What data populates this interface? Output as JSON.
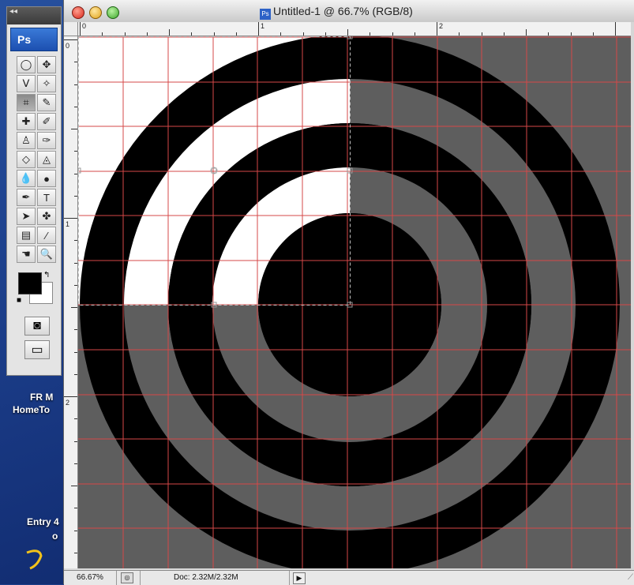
{
  "desktop": {
    "labels": [
      "FR M",
      "HomeTo",
      "Entry 4",
      "o"
    ]
  },
  "toolbox": {
    "logo": "Ps",
    "collapse_glyph": "◂◂",
    "tools": [
      {
        "name": "marquee-tool-icon",
        "glyph": "◯"
      },
      {
        "name": "move-tool-icon",
        "glyph": "✥"
      },
      {
        "name": "lasso-tool-icon",
        "glyph": "ᐯ"
      },
      {
        "name": "magic-wand-tool-icon",
        "glyph": "✧"
      },
      {
        "name": "crop-tool-icon",
        "glyph": "⌗"
      },
      {
        "name": "slice-tool-icon",
        "glyph": "✎"
      },
      {
        "name": "healing-brush-tool-icon",
        "glyph": "✚"
      },
      {
        "name": "brush-tool-icon",
        "glyph": "✐"
      },
      {
        "name": "clone-stamp-tool-icon",
        "glyph": "♙"
      },
      {
        "name": "history-brush-tool-icon",
        "glyph": "✑"
      },
      {
        "name": "eraser-tool-icon",
        "glyph": "◇"
      },
      {
        "name": "paint-bucket-tool-icon",
        "glyph": "◬"
      },
      {
        "name": "blur-tool-icon",
        "glyph": "💧"
      },
      {
        "name": "dodge-tool-icon",
        "glyph": "●"
      },
      {
        "name": "pen-tool-icon",
        "glyph": "✒"
      },
      {
        "name": "type-tool-icon",
        "glyph": "T"
      },
      {
        "name": "path-selection-tool-icon",
        "glyph": "➤"
      },
      {
        "name": "custom-shape-tool-icon",
        "glyph": "✤"
      },
      {
        "name": "notes-tool-icon",
        "glyph": "▤"
      },
      {
        "name": "eyedropper-tool-icon",
        "glyph": "⁄"
      },
      {
        "name": "hand-tool-icon",
        "glyph": "☚"
      },
      {
        "name": "zoom-tool-icon",
        "glyph": "🔍"
      }
    ],
    "active_tool": "crop-tool-icon",
    "fg_color": "#000000",
    "bg_color": "#ffffff",
    "swap_glyph": "↰",
    "default_glyph": "■",
    "quickmask_glyph": "◙",
    "screenmode_glyph": "▭"
  },
  "document": {
    "title": "Untitled-1 @ 66.7% (RGB/8)",
    "ps_icon": "Ps",
    "ruler_h_labels": [
      "0",
      "1",
      "2"
    ],
    "ruler_v_labels": [
      "0",
      "1",
      "2"
    ],
    "zoom": "66.67%",
    "doc_size": "Doc: 2.32M/2.32M",
    "arrow_glyph": "▶",
    "grip_glyph": "⟋",
    "status_icon_glyph": "◎",
    "colors": {
      "ring_black": "#000000",
      "gray_fill": "#5e5e5e",
      "white_fill": "#ffffff",
      "grid_line": "#d64848",
      "marquee": "#bfbfbf"
    }
  }
}
